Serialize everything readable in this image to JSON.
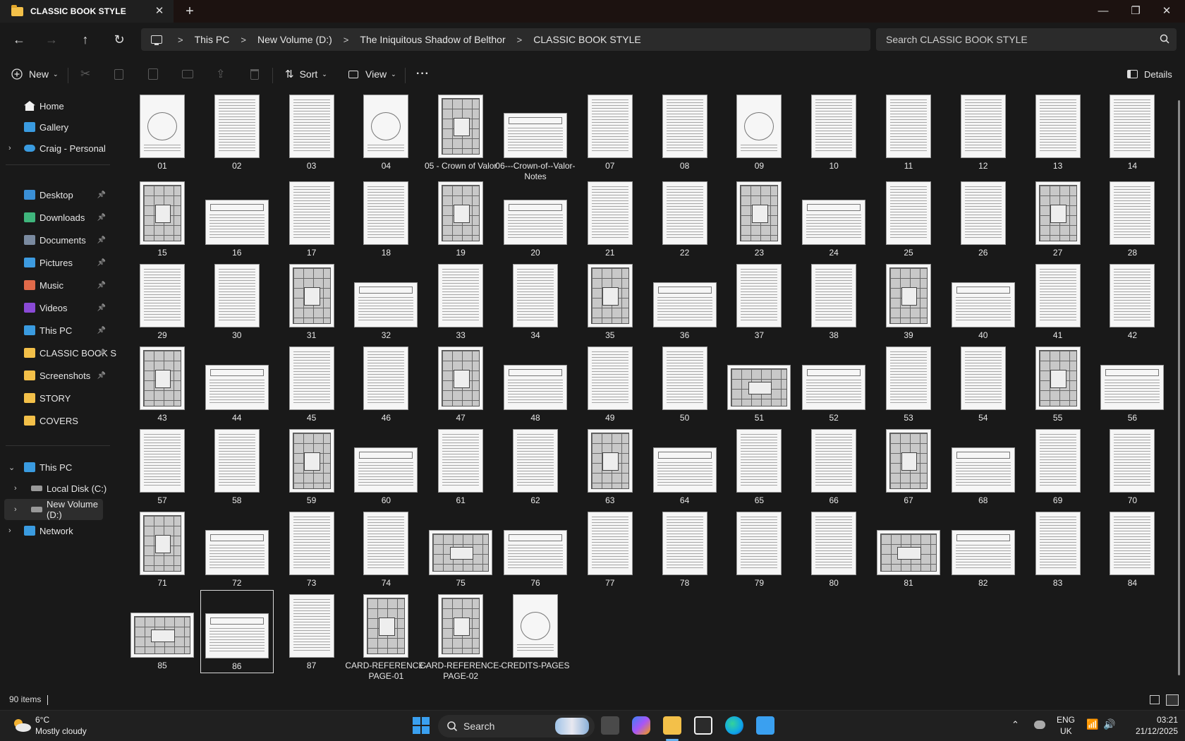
{
  "window": {
    "tab_title": "CLASSIC BOOK STYLE",
    "tab_close": "✕",
    "new_tab": "+",
    "min": "—",
    "max": "❐",
    "close": "✕"
  },
  "address": {
    "crumbs": [
      "This PC",
      "New Volume (D:)",
      "The Iniquitous Shadow of Belthor",
      "CLASSIC BOOK STYLE"
    ],
    "sep": ">"
  },
  "search": {
    "placeholder": "Search CLASSIC BOOK STYLE"
  },
  "toolbar": {
    "new_label": "New",
    "sort_label": "Sort",
    "view_label": "View",
    "more_label": "···",
    "details_label": "Details"
  },
  "nav": {
    "home": "Home",
    "gallery": "Gallery",
    "personal": "Craig - Personal",
    "quick": [
      {
        "label": "Desktop",
        "color": "#3a8fd6"
      },
      {
        "label": "Downloads",
        "color": "#3fb57c"
      },
      {
        "label": "Documents",
        "color": "#7a8aa0"
      },
      {
        "label": "Pictures",
        "color": "#3d9be0"
      },
      {
        "label": "Music",
        "color": "#e06a4a"
      },
      {
        "label": "Videos",
        "color": "#8a4ad6"
      },
      {
        "label": "This PC",
        "color": "#3a9be0"
      },
      {
        "label": "CLASSIC BOOK S",
        "color": "#f3c049"
      },
      {
        "label": "Screenshots",
        "color": "#f3c049"
      },
      {
        "label": "STORY",
        "color": "#f3c049"
      },
      {
        "label": "COVERS",
        "color": "#f3c049"
      }
    ],
    "this_pc": "This PC",
    "local_disk": "Local Disk (C:)",
    "new_volume": "New Volume (D:)",
    "network": "Network"
  },
  "files": [
    {
      "name": "01",
      "o": "p",
      "k": "art"
    },
    {
      "name": "02",
      "o": "p",
      "k": "text"
    },
    {
      "name": "03",
      "o": "p",
      "k": "text"
    },
    {
      "name": "04",
      "o": "p",
      "k": "art"
    },
    {
      "name": "05 - Crown of Valor",
      "o": "p",
      "k": "map"
    },
    {
      "name": "06---Crown-of--Valor-Notes",
      "o": "l",
      "k": "text"
    },
    {
      "name": "07",
      "o": "p",
      "k": "text"
    },
    {
      "name": "08",
      "o": "p",
      "k": "text"
    },
    {
      "name": "09",
      "o": "p",
      "k": "art"
    },
    {
      "name": "10",
      "o": "p",
      "k": "text"
    },
    {
      "name": "11",
      "o": "p",
      "k": "text"
    },
    {
      "name": "12",
      "o": "p",
      "k": "text"
    },
    {
      "name": "13",
      "o": "p",
      "k": "text"
    },
    {
      "name": "14",
      "o": "p",
      "k": "text"
    },
    {
      "name": "15",
      "o": "p",
      "k": "map"
    },
    {
      "name": "16",
      "o": "l",
      "k": "text"
    },
    {
      "name": "17",
      "o": "p",
      "k": "text"
    },
    {
      "name": "18",
      "o": "p",
      "k": "text"
    },
    {
      "name": "19",
      "o": "p",
      "k": "map"
    },
    {
      "name": "20",
      "o": "l",
      "k": "text"
    },
    {
      "name": "21",
      "o": "p",
      "k": "text"
    },
    {
      "name": "22",
      "o": "p",
      "k": "text"
    },
    {
      "name": "23",
      "o": "p",
      "k": "map"
    },
    {
      "name": "24",
      "o": "l",
      "k": "text"
    },
    {
      "name": "25",
      "o": "p",
      "k": "text"
    },
    {
      "name": "26",
      "o": "p",
      "k": "text"
    },
    {
      "name": "27",
      "o": "p",
      "k": "map"
    },
    {
      "name": "28",
      "o": "p",
      "k": "text"
    },
    {
      "name": "29",
      "o": "p",
      "k": "text"
    },
    {
      "name": "30",
      "o": "p",
      "k": "text"
    },
    {
      "name": "31",
      "o": "p",
      "k": "map"
    },
    {
      "name": "32",
      "o": "l",
      "k": "text"
    },
    {
      "name": "33",
      "o": "p",
      "k": "text"
    },
    {
      "name": "34",
      "o": "p",
      "k": "text"
    },
    {
      "name": "35",
      "o": "p",
      "k": "map"
    },
    {
      "name": "36",
      "o": "l",
      "k": "text"
    },
    {
      "name": "37",
      "o": "p",
      "k": "text"
    },
    {
      "name": "38",
      "o": "p",
      "k": "text"
    },
    {
      "name": "39",
      "o": "p",
      "k": "map"
    },
    {
      "name": "40",
      "o": "l",
      "k": "text"
    },
    {
      "name": "41",
      "o": "p",
      "k": "text"
    },
    {
      "name": "42",
      "o": "p",
      "k": "text"
    },
    {
      "name": "43",
      "o": "p",
      "k": "map"
    },
    {
      "name": "44",
      "o": "l",
      "k": "text"
    },
    {
      "name": "45",
      "o": "p",
      "k": "text"
    },
    {
      "name": "46",
      "o": "p",
      "k": "text"
    },
    {
      "name": "47",
      "o": "p",
      "k": "map"
    },
    {
      "name": "48",
      "o": "l",
      "k": "text"
    },
    {
      "name": "49",
      "o": "p",
      "k": "text"
    },
    {
      "name": "50",
      "o": "p",
      "k": "text"
    },
    {
      "name": "51",
      "o": "l",
      "k": "map"
    },
    {
      "name": "52",
      "o": "l",
      "k": "text"
    },
    {
      "name": "53",
      "o": "p",
      "k": "text"
    },
    {
      "name": "54",
      "o": "p",
      "k": "text"
    },
    {
      "name": "55",
      "o": "p",
      "k": "map"
    },
    {
      "name": "56",
      "o": "l",
      "k": "text"
    },
    {
      "name": "57",
      "o": "p",
      "k": "text"
    },
    {
      "name": "58",
      "o": "p",
      "k": "text"
    },
    {
      "name": "59",
      "o": "p",
      "k": "map"
    },
    {
      "name": "60",
      "o": "l",
      "k": "text"
    },
    {
      "name": "61",
      "o": "p",
      "k": "text"
    },
    {
      "name": "62",
      "o": "p",
      "k": "text"
    },
    {
      "name": "63",
      "o": "p",
      "k": "map"
    },
    {
      "name": "64",
      "o": "l",
      "k": "text"
    },
    {
      "name": "65",
      "o": "p",
      "k": "text"
    },
    {
      "name": "66",
      "o": "p",
      "k": "text"
    },
    {
      "name": "67",
      "o": "p",
      "k": "map"
    },
    {
      "name": "68",
      "o": "l",
      "k": "text"
    },
    {
      "name": "69",
      "o": "p",
      "k": "text"
    },
    {
      "name": "70",
      "o": "p",
      "k": "text"
    },
    {
      "name": "71",
      "o": "p",
      "k": "map"
    },
    {
      "name": "72",
      "o": "l",
      "k": "text"
    },
    {
      "name": "73",
      "o": "p",
      "k": "text"
    },
    {
      "name": "74",
      "o": "p",
      "k": "text"
    },
    {
      "name": "75",
      "o": "l",
      "k": "map"
    },
    {
      "name": "76",
      "o": "l",
      "k": "text"
    },
    {
      "name": "77",
      "o": "p",
      "k": "text"
    },
    {
      "name": "78",
      "o": "p",
      "k": "text"
    },
    {
      "name": "79",
      "o": "p",
      "k": "text"
    },
    {
      "name": "80",
      "o": "p",
      "k": "text"
    },
    {
      "name": "81",
      "o": "l",
      "k": "map"
    },
    {
      "name": "82",
      "o": "l",
      "k": "text"
    },
    {
      "name": "83",
      "o": "p",
      "k": "text"
    },
    {
      "name": "84",
      "o": "p",
      "k": "text"
    },
    {
      "name": "85",
      "o": "l",
      "k": "map"
    },
    {
      "name": "86",
      "o": "l",
      "k": "text",
      "selected": true
    },
    {
      "name": "87",
      "o": "p",
      "k": "text"
    },
    {
      "name": "CARD-REFERENCE-PAGE-01",
      "o": "p",
      "k": "map"
    },
    {
      "name": "CARD-REFERENCE-PAGE-02",
      "o": "p",
      "k": "map"
    },
    {
      "name": "CREDITS-PAGES",
      "o": "p",
      "k": "art"
    }
  ],
  "status": {
    "count": "90 items"
  },
  "taskbar": {
    "temp": "6°C",
    "weather": "Mostly cloudy",
    "search": "Search",
    "lang1": "ENG",
    "lang2": "UK",
    "time": "03:21",
    "date": "21/12/2025"
  }
}
